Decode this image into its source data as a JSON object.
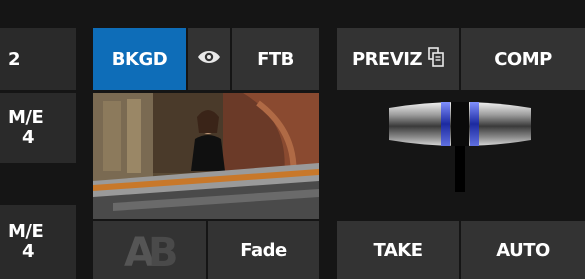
{
  "left_column": {
    "button_2": "2",
    "me_top": {
      "line1": "M/E",
      "line2": "4"
    },
    "me_bottom": {
      "line1": "M/E",
      "line2": "4"
    }
  },
  "top_row": {
    "bkgd": "BKGD",
    "ftb": "FTB",
    "previz": "PREVIZ",
    "comp": "COMP"
  },
  "bottom_row": {
    "fade": "Fade",
    "take": "TAKE",
    "auto": "AUTO"
  },
  "colors": {
    "accent_blue": "#0e6db8",
    "button_gray": "#333333",
    "background": "#151515"
  },
  "icons": {
    "eye": "eye-icon",
    "previz": "previz-window-icon",
    "transition": "ab-transition-icon"
  }
}
